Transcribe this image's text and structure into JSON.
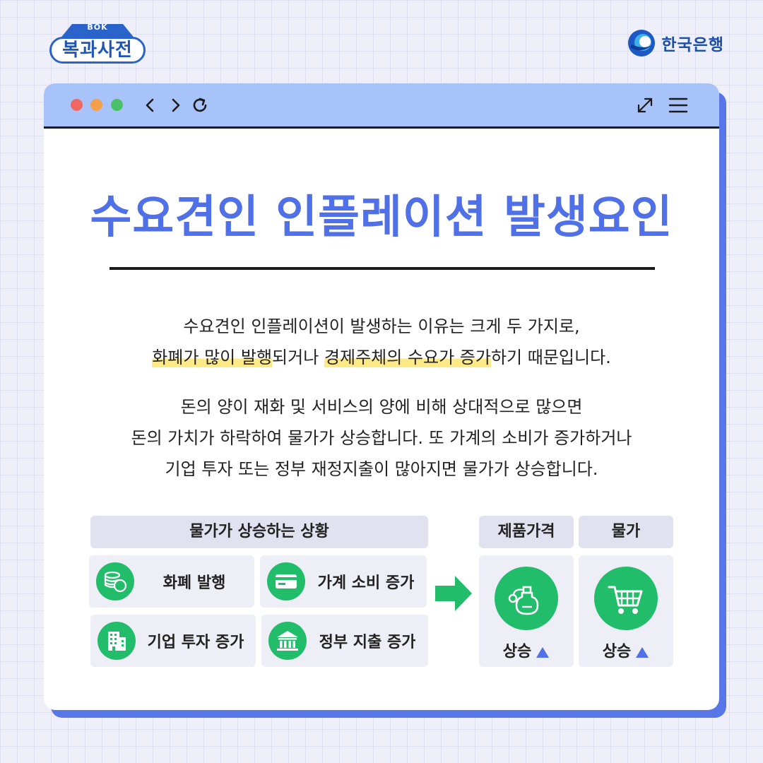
{
  "brand": {
    "series_small": "BOK",
    "series_title": "복과사전",
    "bank_name": "한국은행"
  },
  "window": {
    "title": "수요견인 인플레이션 발생요인"
  },
  "paragraph1": {
    "line1": "수요견인 인플레이션이 발생하는 이유는 크게 두 가지로,",
    "hl1": "화폐가 많이 발행",
    "mid": "되거나 ",
    "hl2": "경제주체의 수요가 증가",
    "end": "하기 때문입니다."
  },
  "paragraph2": {
    "line1": "돈의 양이 재화 및 서비스의 양에 비해 상대적으로 많으면",
    "line2": "돈의 가치가 하락하여 물가가 상승합니다. 또 가계의 소비가 증가하거나",
    "line3": "기업 투자 또는 정부 재정지출이 많아지면 물가가 상승합니다."
  },
  "infographic": {
    "causes_header": "물가가 상승하는 상황",
    "causes": [
      {
        "label": "화폐 발행",
        "icon": "coins-icon"
      },
      {
        "label": "가계 소비 증가",
        "icon": "card-icon"
      },
      {
        "label": "기업 투자 증가",
        "icon": "building-icon"
      },
      {
        "label": "정부 지출 증가",
        "icon": "bank-building-icon"
      }
    ],
    "results": [
      {
        "header": "제품가격",
        "label": "상승",
        "icon": "perfume-bottle-icon"
      },
      {
        "header": "물가",
        "label": "상승",
        "icon": "shopping-cart-icon"
      }
    ],
    "colors": {
      "icon_bg": "#22bd6a",
      "up_triangle": "#4f70e6",
      "title": "#4f70e6",
      "highlight": "#fde986"
    }
  }
}
